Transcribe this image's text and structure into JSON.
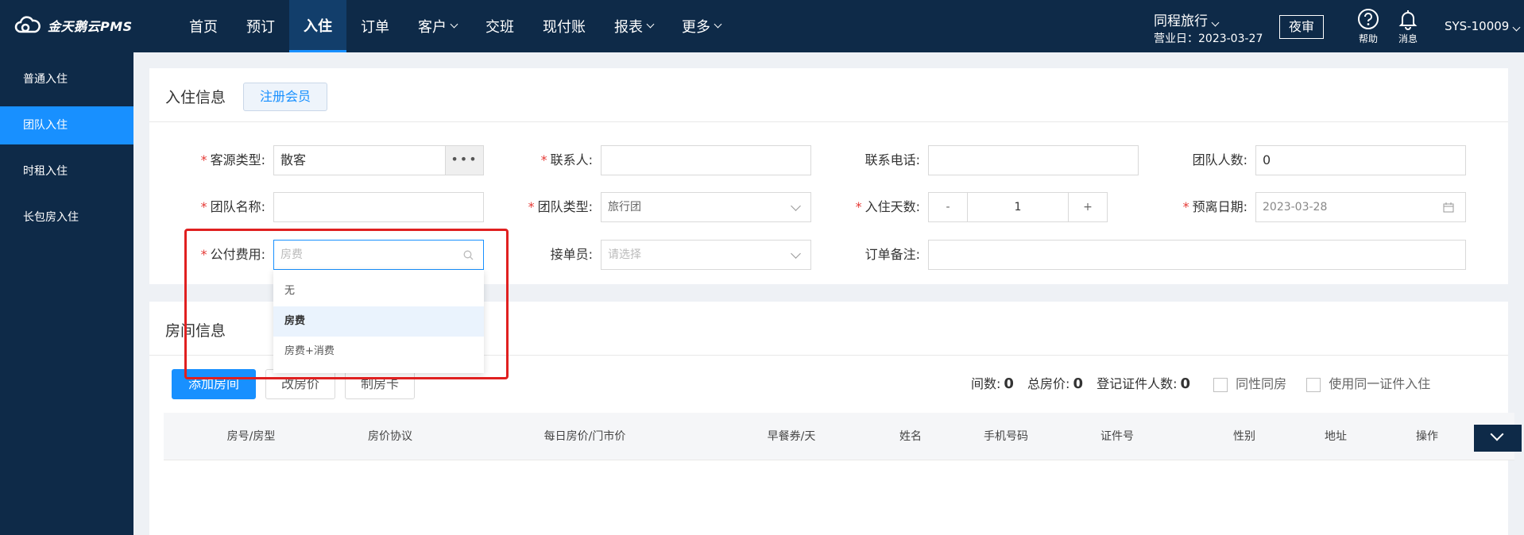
{
  "app": {
    "logo_text": "金天鹅云PMS"
  },
  "nav": {
    "items": [
      {
        "label": "首页",
        "active": false,
        "dropdown": false
      },
      {
        "label": "预订",
        "active": false,
        "dropdown": false
      },
      {
        "label": "入住",
        "active": true,
        "dropdown": false
      },
      {
        "label": "订单",
        "active": false,
        "dropdown": false
      },
      {
        "label": "客户",
        "active": false,
        "dropdown": true
      },
      {
        "label": "交班",
        "active": false,
        "dropdown": false
      },
      {
        "label": "现付账",
        "active": false,
        "dropdown": false
      },
      {
        "label": "报表",
        "active": false,
        "dropdown": true
      },
      {
        "label": "更多",
        "active": false,
        "dropdown": true
      }
    ]
  },
  "header": {
    "agency": "同程旅行",
    "business_date": "营业日：2023-03-27",
    "night_audit": "夜审",
    "help": "帮助",
    "messages": "消息",
    "user": "SYS-10009"
  },
  "sidebar": {
    "items": [
      {
        "label": "普通入住",
        "active": false
      },
      {
        "label": "团队入住",
        "active": true
      },
      {
        "label": "时租入住",
        "active": false
      },
      {
        "label": "长包房入住",
        "active": false
      }
    ]
  },
  "checkin": {
    "title": "入住信息",
    "register_member": "注册会员",
    "source_type_label": "客源类型:",
    "source_type_value": "散客",
    "contact_label": "联系人:",
    "contact_value": "",
    "phone_label": "联系电话:",
    "phone_value": "",
    "group_count_label": "团队人数:",
    "group_count_value": "0",
    "group_name_label": "团队名称:",
    "group_name_value": "",
    "group_type_label": "团队类型:",
    "group_type_value": "旅行团",
    "days_label": "入住天数:",
    "days_minus": "-",
    "days_value": "1",
    "days_plus": "+",
    "departure_label": "预离日期:",
    "departure_value": "2023-03-28",
    "public_fee_label": "公付费用:",
    "public_fee_placeholder": "房费",
    "receiver_label": "接单员:",
    "receiver_placeholder": "请选择",
    "order_note_label": "订单备注:",
    "order_note_value": "",
    "required_mark": "*"
  },
  "fee_dropdown": {
    "options": [
      {
        "label": "无",
        "selected": false
      },
      {
        "label": "房费",
        "selected": true
      },
      {
        "label": "房费+消费",
        "selected": false
      }
    ]
  },
  "rooms": {
    "title": "房间信息",
    "add_room": "添加房间",
    "change_price": "改房价",
    "make_card": "制房卡",
    "room_count_label": "间数:",
    "room_count": "0",
    "total_price_label": "总房价:",
    "total_price": "0",
    "id_count_label": "登记证件人数:",
    "id_count": "0",
    "same_gender": "同性同房",
    "same_id": "使用同一证件入住",
    "columns": [
      "房号/房型",
      "房价协议",
      "每日房价/门市价",
      "早餐券/天",
      "姓名",
      "手机号码",
      "证件号",
      "性别",
      "地址",
      "操作"
    ]
  },
  "colors": {
    "nav_bg": "#0e2a48",
    "accent": "#1890ff",
    "highlight": "#e02020"
  }
}
